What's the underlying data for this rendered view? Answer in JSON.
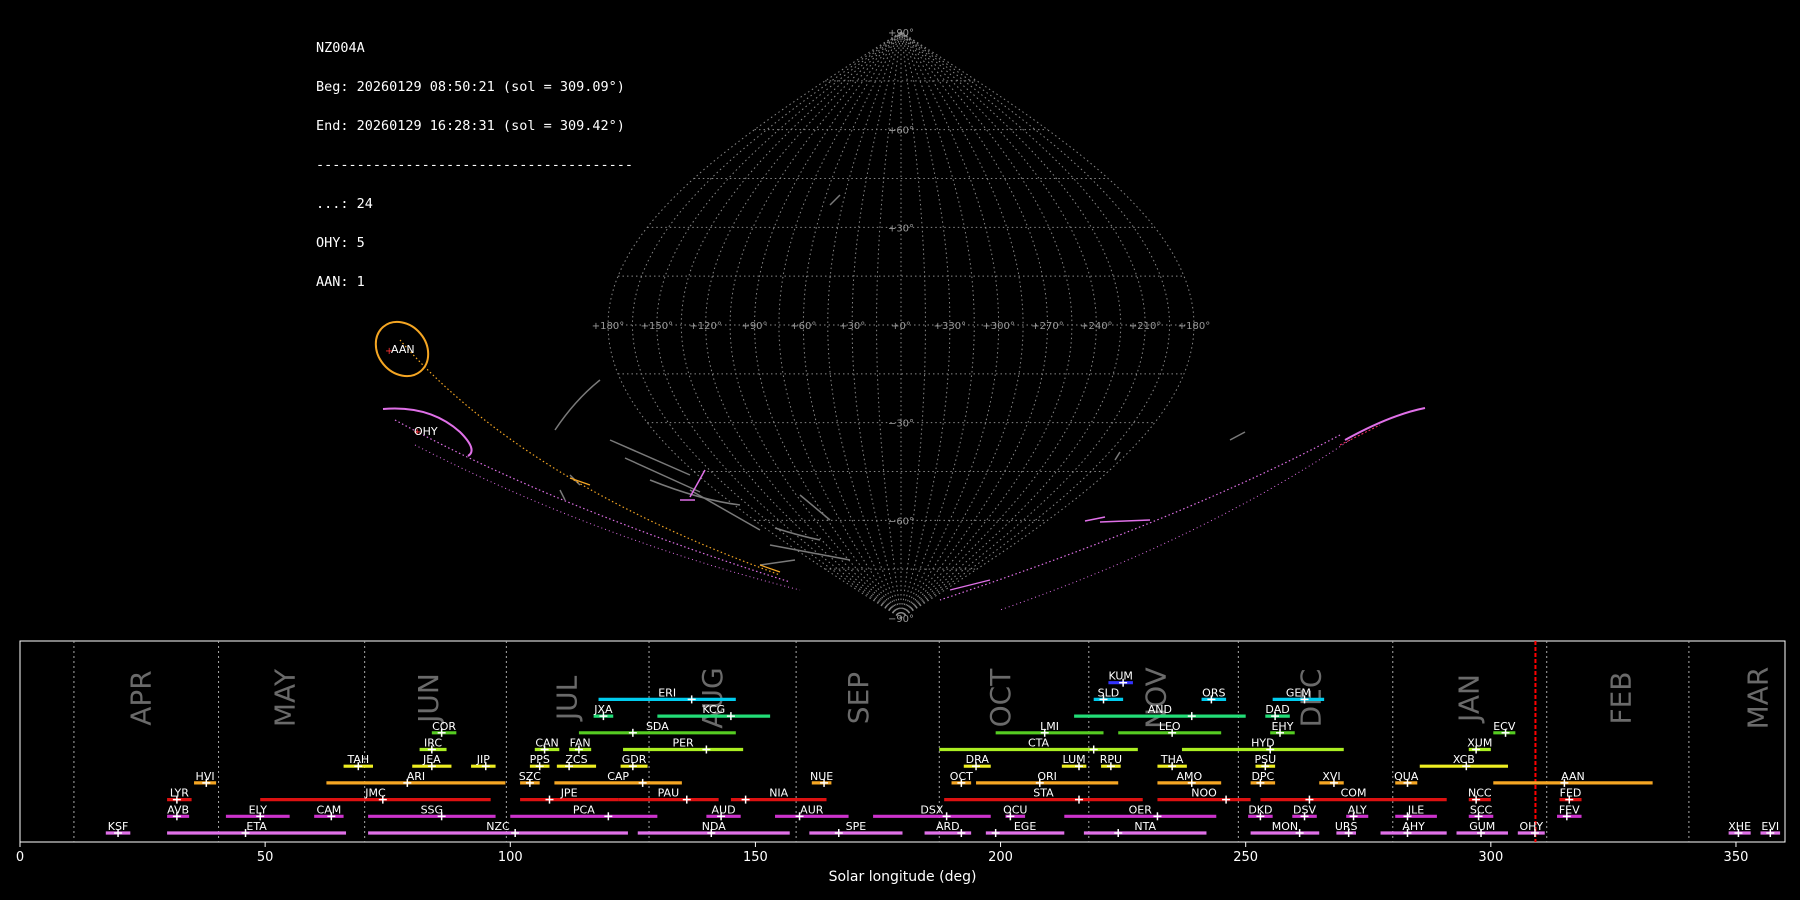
{
  "info": {
    "station": "NZ004A",
    "beg": "Beg: 20260129 08:50:21 (sol = 309.09°)",
    "end": "End: 20260129 16:28:31 (sol = 309.42°)",
    "separator": "---------------------------------------",
    "counts": [
      "...: 24",
      "OHY: 5",
      "AAN: 1"
    ]
  },
  "colors": {
    "background": "#000000",
    "grid": "#888888",
    "sky_labels": "#999999",
    "month_labels": "#6a6a6a",
    "current_marker": "#ff0000"
  },
  "sky_map": {
    "projection": "sinusoidal",
    "meridian_labels": [
      "+180°",
      "+150°",
      "+120°",
      "+90°",
      "+60°",
      "+30°",
      "+0°",
      "+330°",
      "+300°",
      "+270°",
      "+240°",
      "+210°",
      "+180°"
    ],
    "meridian_lons": [
      180,
      150,
      120,
      90,
      60,
      30,
      0,
      330,
      300,
      270,
      240,
      210,
      180
    ],
    "parallel_labels": [
      {
        "lat": 90,
        "text": "+90°"
      },
      {
        "lat": 60,
        "text": "+60°"
      },
      {
        "lat": 30,
        "text": "+30°"
      },
      {
        "lat": -30,
        "text": "−30°"
      },
      {
        "lat": -60,
        "text": "−60°"
      },
      {
        "lat": -90,
        "text": "−90°"
      }
    ],
    "showers": [
      {
        "code": "AAN",
        "color": "#f5a623",
        "lon": 155,
        "lat": -8
      },
      {
        "code": "OHY",
        "color": "#e070e8",
        "lon": 152,
        "lat": -24
      }
    ]
  },
  "chart_data": {
    "type": "bar",
    "xlabel": "Solar longitude (deg)",
    "xlim": [
      0,
      360
    ],
    "x_ticks": [
      "0",
      "50",
      "100",
      "150",
      "200",
      "250",
      "300",
      "350"
    ],
    "x_tick_values": [
      0,
      50,
      100,
      150,
      200,
      250,
      300,
      350
    ],
    "current_sol": 309.1,
    "months": [
      {
        "label": "APR",
        "sol": 24.7,
        "boundary": 11
      },
      {
        "label": "MAY",
        "sol": 54,
        "boundary": 40.5
      },
      {
        "label": "JUN",
        "sol": 83.3,
        "boundary": 70.3
      },
      {
        "label": "JUL",
        "sol": 111.6,
        "boundary": 99.2
      },
      {
        "label": "AUG",
        "sol": 141.2,
        "boundary": 128.3
      },
      {
        "label": "SEP",
        "sol": 171,
        "boundary": 158.3
      },
      {
        "label": "OCT",
        "sol": 200,
        "boundary": 187.5
      },
      {
        "label": "NOV",
        "sol": 231.7,
        "boundary": 218
      },
      {
        "label": "DEC",
        "sol": 263.3,
        "boundary": 248.5
      },
      {
        "label": "JAN",
        "sol": 295.5,
        "boundary": 280
      },
      {
        "label": "FEB",
        "sol": 326.5,
        "boundary": 311.4
      },
      {
        "label": "MAR",
        "sol": 354.5,
        "boundary": 340.4
      }
    ],
    "showers": [
      {
        "code": "KSF",
        "start": 17.5,
        "end": 22.5,
        "peak": 20,
        "row": 0,
        "color": "#e070e8"
      },
      {
        "code": "ETA",
        "start": 30,
        "end": 66.5,
        "peak": 46,
        "row": 0,
        "color": "#e070e8"
      },
      {
        "code": "NZC",
        "start": 71,
        "end": 124,
        "peak": 101,
        "row": 0,
        "color": "#e070e8"
      },
      {
        "code": "NDA",
        "start": 126,
        "end": 157,
        "peak": 141,
        "row": 0,
        "color": "#e070e8"
      },
      {
        "code": "SPE",
        "start": 161,
        "end": 180,
        "peak": 167,
        "row": 0,
        "color": "#e070e8"
      },
      {
        "code": "ARD",
        "start": 184.5,
        "end": 194,
        "peak": 192,
        "row": 0,
        "color": "#e070e8"
      },
      {
        "code": "EGE",
        "start": 197,
        "end": 213,
        "peak": 199,
        "row": 0,
        "color": "#e070e8"
      },
      {
        "code": "NTA",
        "start": 217,
        "end": 242,
        "peak": 224,
        "row": 0,
        "color": "#e070e8"
      },
      {
        "code": "MON",
        "start": 251,
        "end": 265,
        "peak": 261,
        "row": 0,
        "color": "#e070e8"
      },
      {
        "code": "URS",
        "start": 268.5,
        "end": 272.5,
        "peak": 271,
        "row": 0,
        "color": "#e070e8"
      },
      {
        "code": "AHY",
        "start": 277.5,
        "end": 291,
        "peak": 283,
        "row": 0,
        "color": "#e070e8"
      },
      {
        "code": "GUM",
        "start": 293,
        "end": 303.5,
        "peak": 298,
        "row": 0,
        "color": "#e070e8"
      },
      {
        "code": "OHY",
        "start": 305.5,
        "end": 311,
        "peak": 309,
        "row": 0,
        "color": "#e070e8"
      },
      {
        "code": "XHE",
        "start": 348.5,
        "end": 353,
        "peak": 350.5,
        "row": 0,
        "color": "#e070e8"
      },
      {
        "code": "EVI",
        "start": 355,
        "end": 359,
        "peak": 357,
        "row": 0,
        "color": "#e070e8"
      },
      {
        "code": "AVB",
        "start": 30,
        "end": 34.5,
        "peak": 32,
        "row": 1,
        "color": "#cc33cc"
      },
      {
        "code": "ELY",
        "start": 42,
        "end": 55,
        "peak": 49,
        "row": 1,
        "color": "#cc33cc"
      },
      {
        "code": "CAM",
        "start": 60,
        "end": 66,
        "peak": 63.5,
        "row": 1,
        "color": "#cc33cc"
      },
      {
        "code": "SSG",
        "start": 71,
        "end": 97,
        "peak": 86,
        "row": 1,
        "color": "#cc33cc"
      },
      {
        "code": "PCA",
        "start": 100,
        "end": 130,
        "peak": 120,
        "row": 1,
        "color": "#cc33cc"
      },
      {
        "code": "AUD",
        "start": 140,
        "end": 147,
        "peak": 143,
        "row": 1,
        "color": "#cc33cc"
      },
      {
        "code": "AUR",
        "start": 154,
        "end": 169,
        "peak": 159,
        "row": 1,
        "color": "#cc33cc"
      },
      {
        "code": "DSX",
        "start": 174,
        "end": 198,
        "peak": 189,
        "row": 1,
        "color": "#cc33cc"
      },
      {
        "code": "OCU",
        "start": 201,
        "end": 205,
        "peak": 202,
        "row": 1,
        "color": "#cc33cc"
      },
      {
        "code": "OER",
        "start": 213,
        "end": 244,
        "peak": 232,
        "row": 1,
        "color": "#cc33cc"
      },
      {
        "code": "DKD",
        "start": 250.5,
        "end": 255.5,
        "peak": 253,
        "row": 1,
        "color": "#cc33cc"
      },
      {
        "code": "DSV",
        "start": 259.5,
        "end": 264.5,
        "peak": 262,
        "row": 1,
        "color": "#cc33cc"
      },
      {
        "code": "ALY",
        "start": 270.5,
        "end": 275,
        "peak": 272,
        "row": 1,
        "color": "#cc33cc"
      },
      {
        "code": "JLE",
        "start": 280.5,
        "end": 289,
        "peak": 283,
        "row": 1,
        "color": "#cc33cc"
      },
      {
        "code": "SCC",
        "start": 295.5,
        "end": 300.5,
        "peak": 297.5,
        "row": 1,
        "color": "#cc33cc"
      },
      {
        "code": "FEV",
        "start": 313.5,
        "end": 318.5,
        "peak": 315.5,
        "row": 1,
        "color": "#cc33cc"
      },
      {
        "code": "LYR",
        "start": 30,
        "end": 35,
        "peak": 32,
        "row": 2,
        "color": "#dd1111"
      },
      {
        "code": "JMC",
        "start": 49,
        "end": 96,
        "peak": 74,
        "row": 2,
        "color": "#dd1111"
      },
      {
        "code": "JPE",
        "start": 102,
        "end": 122,
        "peak": 108,
        "row": 2,
        "color": "#dd1111"
      },
      {
        "code": "PAU",
        "start": 122,
        "end": 142.5,
        "peak": 136,
        "row": 2,
        "color": "#dd1111"
      },
      {
        "code": "NIA",
        "start": 145,
        "end": 164.5,
        "peak": 148,
        "row": 2,
        "color": "#dd1111"
      },
      {
        "code": "STA",
        "start": 188.5,
        "end": 229,
        "peak": 216,
        "row": 2,
        "color": "#dd1111"
      },
      {
        "code": "NOO",
        "start": 232,
        "end": 251,
        "peak": 246,
        "row": 2,
        "color": "#dd1111"
      },
      {
        "code": "COM",
        "start": 253,
        "end": 291,
        "peak": 263,
        "row": 2,
        "color": "#dd1111"
      },
      {
        "code": "NCC",
        "start": 295.5,
        "end": 300,
        "peak": 297,
        "row": 2,
        "color": "#dd1111"
      },
      {
        "code": "FED",
        "start": 314,
        "end": 318.5,
        "peak": 316,
        "row": 2,
        "color": "#dd1111"
      },
      {
        "code": "HVI",
        "start": 35.5,
        "end": 40,
        "peak": 38,
        "row": 3,
        "color": "#f5a623"
      },
      {
        "code": "ARI",
        "start": 62.5,
        "end": 99,
        "peak": 79,
        "row": 3,
        "color": "#f5a623"
      },
      {
        "code": "SZC",
        "start": 102,
        "end": 106,
        "peak": 104,
        "row": 3,
        "color": "#f5a623"
      },
      {
        "code": "CAP",
        "start": 109,
        "end": 135,
        "peak": 127,
        "row": 3,
        "color": "#f5a623"
      },
      {
        "code": "NUE",
        "start": 161.5,
        "end": 165.5,
        "peak": 164,
        "row": 3,
        "color": "#f5a623"
      },
      {
        "code": "OCT",
        "start": 190,
        "end": 194,
        "peak": 192,
        "row": 3,
        "color": "#f5a623"
      },
      {
        "code": "ORI",
        "start": 195,
        "end": 224,
        "peak": 208,
        "row": 3,
        "color": "#f5a623"
      },
      {
        "code": "AMO",
        "start": 232,
        "end": 245,
        "peak": 239,
        "row": 3,
        "color": "#f5a623"
      },
      {
        "code": "DPC",
        "start": 251,
        "end": 256,
        "peak": 253,
        "row": 3,
        "color": "#f5a623"
      },
      {
        "code": "XVI",
        "start": 265,
        "end": 270,
        "peak": 268,
        "row": 3,
        "color": "#f5a623"
      },
      {
        "code": "QUA",
        "start": 280.5,
        "end": 285,
        "peak": 283,
        "row": 3,
        "color": "#f5a623"
      },
      {
        "code": "AAN",
        "start": 300.5,
        "end": 333,
        "peak": 315,
        "row": 3,
        "color": "#f5a623"
      },
      {
        "code": "TAH",
        "start": 66,
        "end": 72,
        "peak": 69,
        "row": 4,
        "color": "#eeee22"
      },
      {
        "code": "JEA",
        "start": 80,
        "end": 88,
        "peak": 84,
        "row": 4,
        "color": "#eeee22"
      },
      {
        "code": "JIP",
        "start": 92,
        "end": 97,
        "peak": 95,
        "row": 4,
        "color": "#eeee22"
      },
      {
        "code": "PPS",
        "start": 104,
        "end": 108,
        "peak": 106,
        "row": 4,
        "color": "#eeee22"
      },
      {
        "code": "ZCS",
        "start": 109.5,
        "end": 117.5,
        "peak": 112,
        "row": 4,
        "color": "#eeee22"
      },
      {
        "code": "GDR",
        "start": 122.5,
        "end": 128,
        "peak": 125,
        "row": 4,
        "color": "#eeee22"
      },
      {
        "code": "DRA",
        "start": 192.5,
        "end": 198,
        "peak": 195,
        "row": 4,
        "color": "#eeee22"
      },
      {
        "code": "LUM",
        "start": 212.5,
        "end": 217.5,
        "peak": 216,
        "row": 4,
        "color": "#eeee22"
      },
      {
        "code": "RPU",
        "start": 220.5,
        "end": 224.5,
        "peak": 222.5,
        "row": 4,
        "color": "#eeee22"
      },
      {
        "code": "THA",
        "start": 232,
        "end": 238,
        "peak": 235,
        "row": 4,
        "color": "#eeee22"
      },
      {
        "code": "PSU",
        "start": 252,
        "end": 256,
        "peak": 254,
        "row": 4,
        "color": "#eeee22"
      },
      {
        "code": "XCB",
        "start": 285.5,
        "end": 303.5,
        "peak": 295,
        "row": 4,
        "color": "#eeee22"
      },
      {
        "code": "IRC",
        "start": 81.5,
        "end": 87,
        "peak": 84,
        "row": 5,
        "color": "#aaee22"
      },
      {
        "code": "CAN",
        "start": 105,
        "end": 110,
        "peak": 107,
        "row": 5,
        "color": "#aaee22"
      },
      {
        "code": "FAN",
        "start": 112,
        "end": 116.5,
        "peak": 114,
        "row": 5,
        "color": "#aaee22"
      },
      {
        "code": "PER",
        "start": 123,
        "end": 147.5,
        "peak": 140,
        "row": 5,
        "color": "#aaee22"
      },
      {
        "code": "CTA",
        "start": 187.5,
        "end": 228,
        "peak": 219,
        "row": 5,
        "color": "#aaee22"
      },
      {
        "code": "HYD",
        "start": 237,
        "end": 270,
        "peak": 255,
        "row": 5,
        "color": "#aaee22"
      },
      {
        "code": "XUM",
        "start": 295.5,
        "end": 300,
        "peak": 297,
        "row": 5,
        "color": "#aaee22"
      },
      {
        "code": "COR",
        "start": 84,
        "end": 89,
        "peak": 86,
        "row": 6,
        "color": "#55cc22"
      },
      {
        "code": "SDA",
        "start": 114,
        "end": 146,
        "peak": 125,
        "row": 6,
        "color": "#55cc22"
      },
      {
        "code": "LMI",
        "start": 199,
        "end": 221,
        "peak": 209,
        "row": 6,
        "color": "#55cc22"
      },
      {
        "code": "LEO",
        "start": 224,
        "end": 245,
        "peak": 235,
        "row": 6,
        "color": "#55cc22"
      },
      {
        "code": "EHY",
        "start": 255,
        "end": 260,
        "peak": 257,
        "row": 6,
        "color": "#55cc22"
      },
      {
        "code": "ECV",
        "start": 300.5,
        "end": 305,
        "peak": 303,
        "row": 6,
        "color": "#55cc22"
      },
      {
        "code": "JXA",
        "start": 117,
        "end": 121,
        "peak": 119,
        "row": 7,
        "color": "#22dd77"
      },
      {
        "code": "KCG",
        "start": 130,
        "end": 153,
        "peak": 145,
        "row": 7,
        "color": "#22dd77"
      },
      {
        "code": "AND",
        "start": 215,
        "end": 250,
        "peak": 239,
        "row": 7,
        "color": "#22dd77"
      },
      {
        "code": "DAD",
        "start": 254,
        "end": 259,
        "peak": 256,
        "row": 7,
        "color": "#22dd77"
      },
      {
        "code": "ERI",
        "start": 118,
        "end": 146,
        "peak": 137,
        "row": 8,
        "color": "#00ccee"
      },
      {
        "code": "SLD",
        "start": 219,
        "end": 225,
        "peak": 221,
        "row": 8,
        "color": "#00ccee"
      },
      {
        "code": "ORS",
        "start": 241,
        "end": 246,
        "peak": 243,
        "row": 8,
        "color": "#00ccee"
      },
      {
        "code": "GEM",
        "start": 255.5,
        "end": 266,
        "peak": 262,
        "row": 8,
        "color": "#00ccee"
      },
      {
        "code": "KUM",
        "start": 222,
        "end": 227,
        "peak": 225,
        "row": 9,
        "color": "#3333ff"
      }
    ]
  }
}
